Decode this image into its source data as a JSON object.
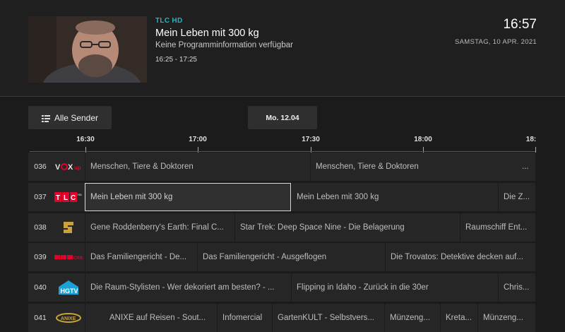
{
  "header": {
    "channel": "TLC HD",
    "title": "Mein Leben mit 300 kg",
    "info": "Keine Programminformation verfügbar",
    "time": "16:25 - 17:25",
    "clock": "16:57",
    "date": "SAMSTAG, 10 APR. 2021"
  },
  "toolbar": {
    "filter_label": "Alle Sender",
    "date_label": "Mo. 12.04"
  },
  "timeline": [
    "16:30",
    "17:00",
    "17:30",
    "18:00",
    "18:"
  ],
  "channels": [
    {
      "number": "036",
      "logo": "VOX up",
      "programs": [
        "Menschen, Tiere & Doktoren",
        "Menschen, Tiere & Doktoren",
        "..."
      ]
    },
    {
      "number": "037",
      "logo": "TLC HD",
      "programs": [
        "Mein Leben mit 300 kg",
        "Mein Leben mit 300 kg",
        "Die Z..."
      ]
    },
    {
      "number": "038",
      "logo": "Sci-Fi channel logo",
      "programs": [
        "Gene Roddenberry's Earth: Final C...",
        "Star Trek: Deep Space Nine - Die Belagerung",
        "Raumschiff Ent..."
      ]
    },
    {
      "number": "039",
      "logo": "RTL Crime",
      "programs": [
        "Das Familiengericht - De...",
        "Das Familiengericht - Ausgeflogen",
        "Die Trovatos: Detektive decken auf..."
      ]
    },
    {
      "number": "040",
      "logo": "HGTV",
      "programs": [
        "Die Raum-Stylisten - Wer dekoriert am besten? - ...",
        "Flipping in Idaho - Zurück in die 30er",
        "Chris..."
      ]
    },
    {
      "number": "041",
      "logo": "Anixe",
      "programs": [
        "ANIXE auf Reisen - Sout...",
        "Infomercial",
        "GartenKULT - Selbstvers...",
        "Münzeng...",
        "Kreta...",
        "Münzeng..."
      ]
    }
  ],
  "colors": {
    "accent": "#2ab3bf",
    "background": "#1b1b1b",
    "cell": "#262626",
    "tlc_red": "#e4002b",
    "hgtv_blue": "#1aa2d8"
  }
}
